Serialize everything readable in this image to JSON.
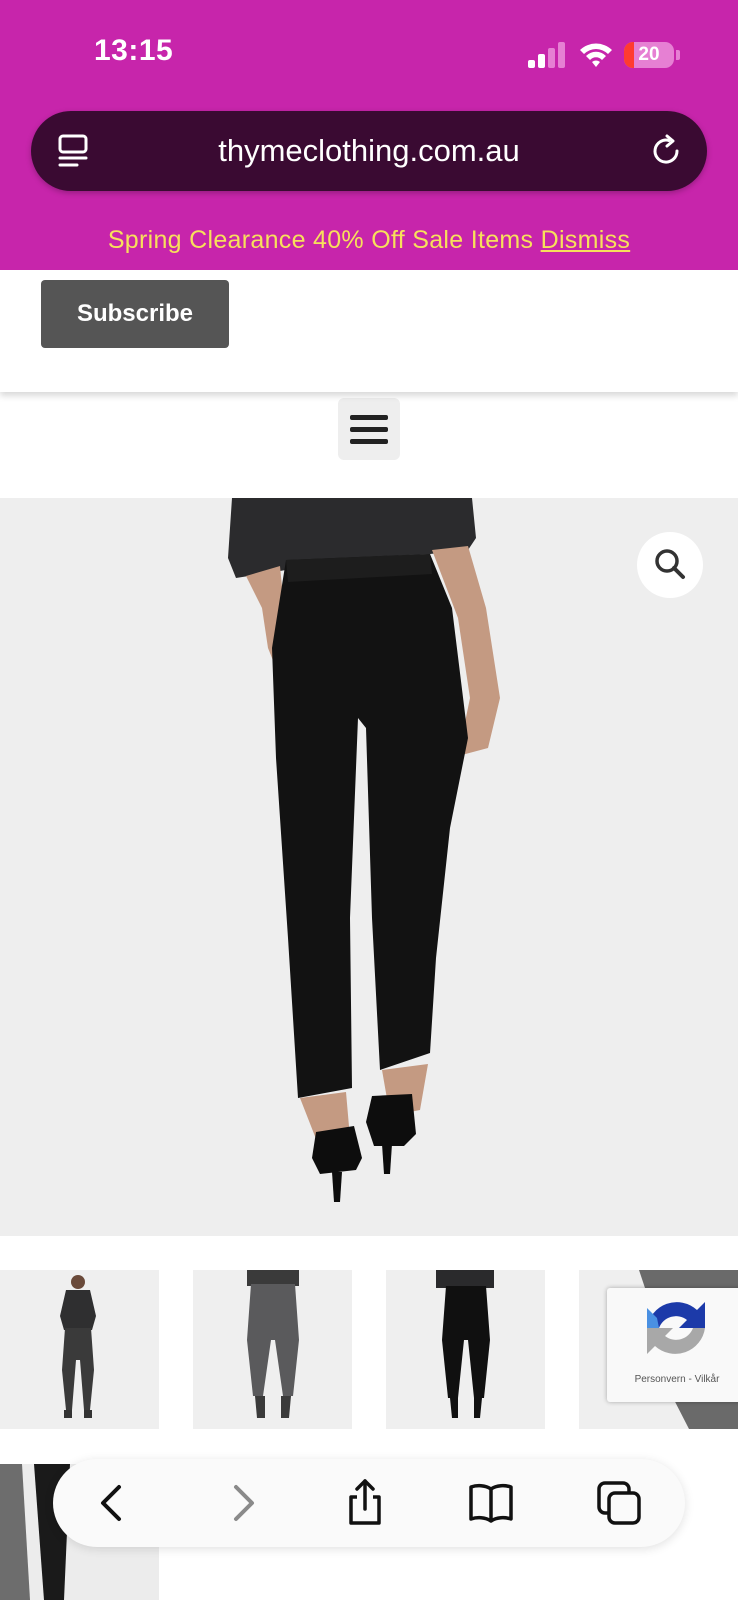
{
  "status_bar": {
    "time": "13:15",
    "battery_level": "20",
    "battery_fraction": 0.2
  },
  "browser": {
    "url": "thymeclothing.com.au"
  },
  "banner": {
    "text": "Spring Clearance 40% Off Sale Items",
    "dismiss_label": "Dismiss"
  },
  "page": {
    "subscribe_label": "Subscribe"
  },
  "recaptcha": {
    "privacy_label": "Personvern",
    "separator": "-",
    "terms_label": "Vilkår"
  },
  "toolbar": {
    "items": [
      "back",
      "forward",
      "share",
      "bookmarks",
      "tabs"
    ]
  },
  "colors": {
    "brand_magenta": "#c725ab",
    "url_bar": "#3a0a32",
    "banner_text": "#f7e05b",
    "button_gray": "#555555"
  },
  "icons": [
    "tab-overview-icon",
    "reload-icon",
    "hamburger-menu-icon",
    "search-zoom-icon",
    "recaptcha-logo-icon",
    "back-chevron-icon",
    "forward-chevron-icon",
    "share-icon",
    "bookmarks-book-icon",
    "tabs-icon"
  ]
}
